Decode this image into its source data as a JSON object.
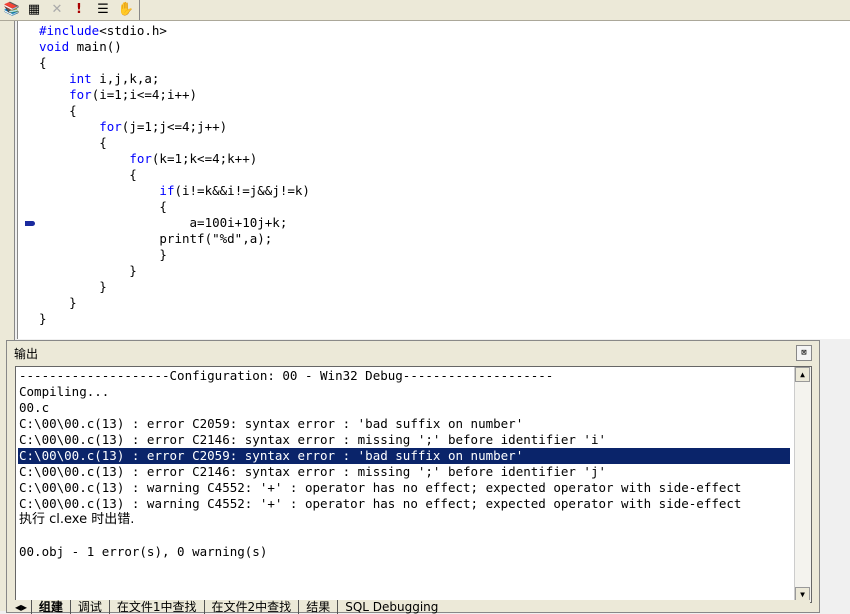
{
  "toolbar": {
    "icons": [
      "compile-icon",
      "build-icon",
      "stop-build-icon",
      "execute-icon",
      "step-into-icon",
      "go-hand-icon"
    ]
  },
  "editor": {
    "lines": [
      "#include<stdio.h>",
      "void main()",
      "{",
      "    int i,j,k,a;",
      "    for(i=1;i<=4;i++)",
      "    {",
      "        for(j=1;j<=4;j++)",
      "        {",
      "            for(k=1;k<=4;k++)",
      "            {",
      "                if(i!=k&&i!=j&&j!=k)",
      "                {",
      "                    a=100i+10j+k;",
      "                printf(\"%d\",a);",
      "                }",
      "            }",
      "        }",
      "    }",
      "}"
    ],
    "keywords": [
      "#include",
      "void",
      "int",
      "for",
      "if"
    ],
    "marker_line": 13
  },
  "output": {
    "title": "输出",
    "close": "⊠",
    "lines": [
      "--------------------Configuration: 00 - Win32 Debug--------------------",
      "Compiling...",
      "00.c",
      "C:\\00\\00.c(13) : error C2059: syntax error : 'bad suffix on number'",
      "C:\\00\\00.c(13) : error C2146: syntax error : missing ';' before identifier 'i'",
      "C:\\00\\00.c(13) : error C2059: syntax error : 'bad suffix on number'",
      "C:\\00\\00.c(13) : error C2146: syntax error : missing ';' before identifier 'j'",
      "C:\\00\\00.c(13) : warning C4552: '+' : operator has no effect; expected operator with side-effect",
      "C:\\00\\00.c(13) : warning C4552: '+' : operator has no effect; expected operator with side-effect",
      "执行 cl.exe 时出错.",
      "",
      "00.obj - 1 error(s), 0 warning(s)"
    ],
    "selected_line": 5,
    "tabs": [
      "组建",
      "调试",
      "在文件1中查找",
      "在文件2中查找",
      "结果",
      "SQL Debugging"
    ],
    "active_tab": 0
  }
}
